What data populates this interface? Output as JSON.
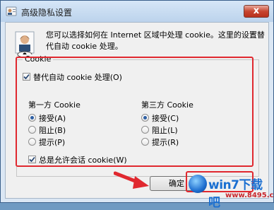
{
  "window": {
    "title": "高级隐私设置",
    "close_glyph": "x"
  },
  "description": "您可以选择如何在 Internet 区域中处理 cookie。这里的设置替代自动 cookie 处理。",
  "group": {
    "legend": "Cookie",
    "override_auto": {
      "label": "替代自动 cookie 处理(O)",
      "checked": true
    },
    "first_party": {
      "heading": "第一方 Cookie",
      "options": [
        "接受(A)",
        "阻止(B)",
        "提示(P)"
      ],
      "selected": "接受(A)"
    },
    "third_party": {
      "heading": "第三方 Cookie",
      "options": [
        "接受(C)",
        "阻止(L)",
        "提示(R)"
      ],
      "selected": "接受(C)"
    },
    "always_session": {
      "label": "总是允许会话 cookie(W)",
      "checked": true
    }
  },
  "buttons": {
    "ok_label": "确定"
  },
  "watermark": {
    "brand": "win7下载吧",
    "url": "www.8495.com"
  },
  "colors": {
    "highlight_frame": "#e0282f",
    "radio_dot": "#2e5fa3"
  }
}
